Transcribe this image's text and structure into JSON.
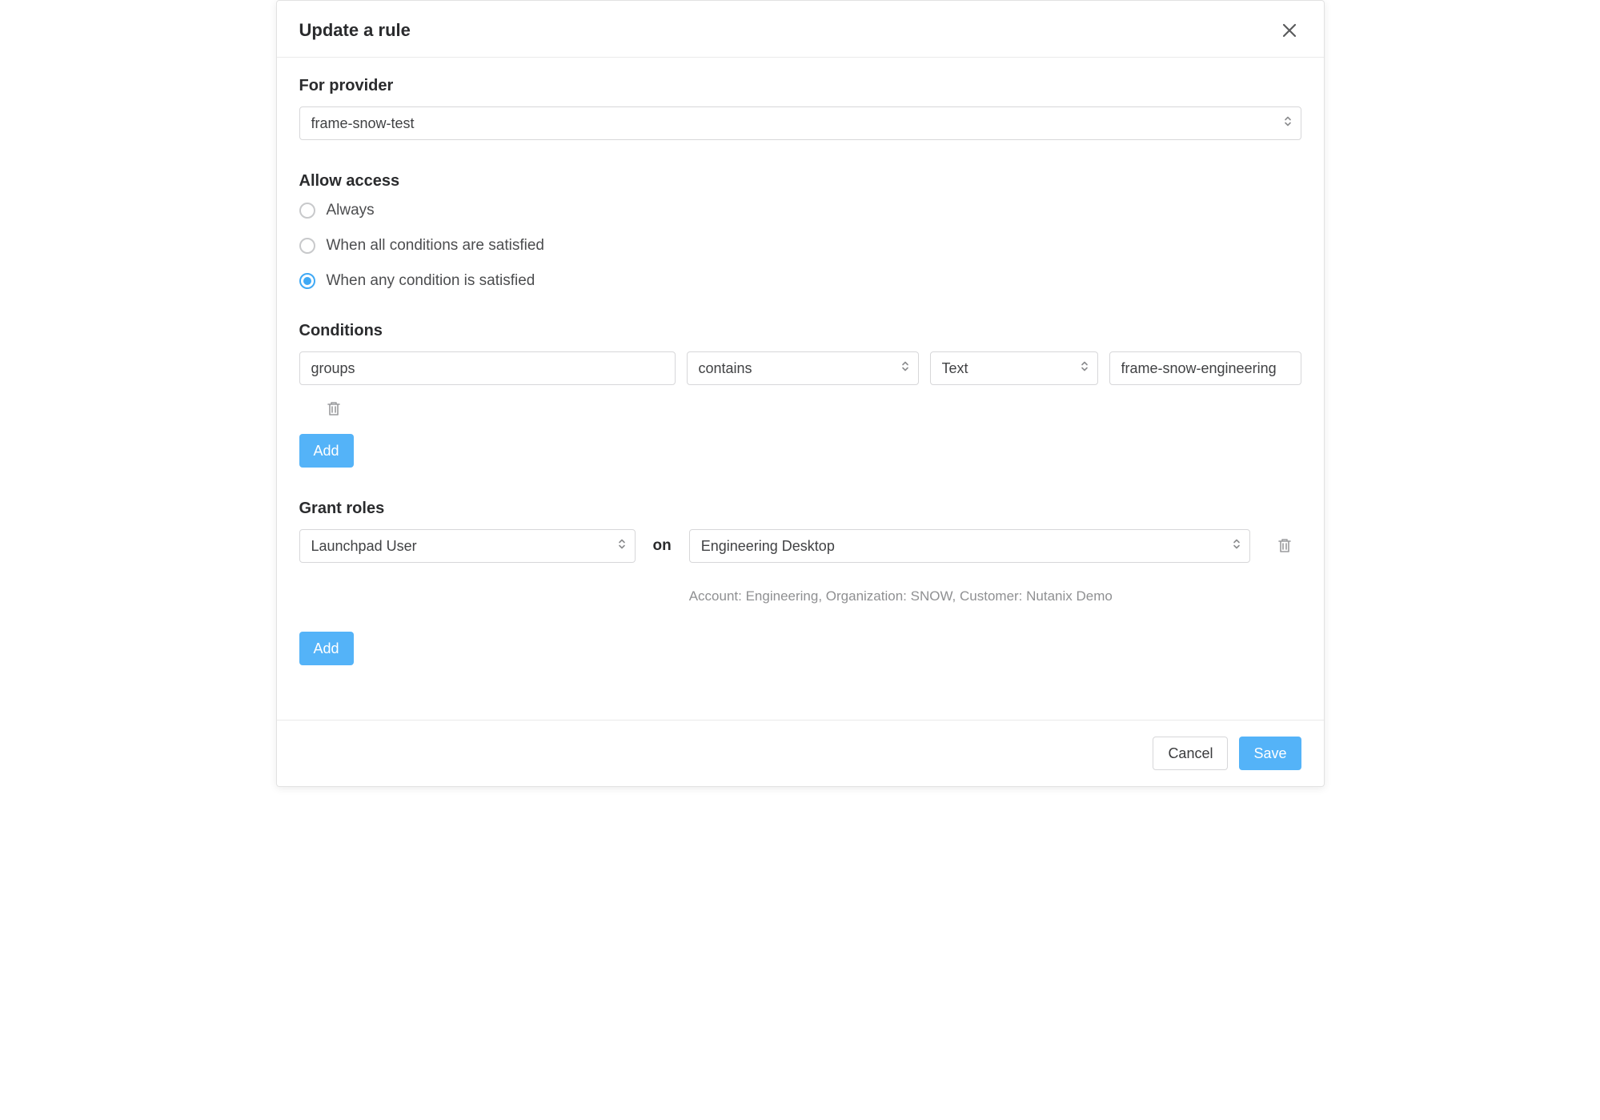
{
  "header": {
    "title": "Update a rule"
  },
  "provider": {
    "label": "For provider",
    "value": "frame-snow-test"
  },
  "access": {
    "label": "Allow access",
    "options": [
      {
        "label": "Always",
        "checked": false
      },
      {
        "label": "When all conditions are satisfied",
        "checked": false
      },
      {
        "label": "When any condition is satisfied",
        "checked": true
      }
    ]
  },
  "conditions": {
    "label": "Conditions",
    "row": {
      "field": "groups",
      "operator": "contains",
      "type": "Text",
      "value": "frame-snow-engineering"
    },
    "add_label": "Add"
  },
  "roles": {
    "label": "Grant roles",
    "role": "Launchpad User",
    "on_label": "on",
    "target": "Engineering Desktop",
    "hint": "Account: Engineering, Organization: SNOW, Customer: Nutanix Demo",
    "add_label": "Add"
  },
  "footer": {
    "cancel": "Cancel",
    "save": "Save"
  }
}
